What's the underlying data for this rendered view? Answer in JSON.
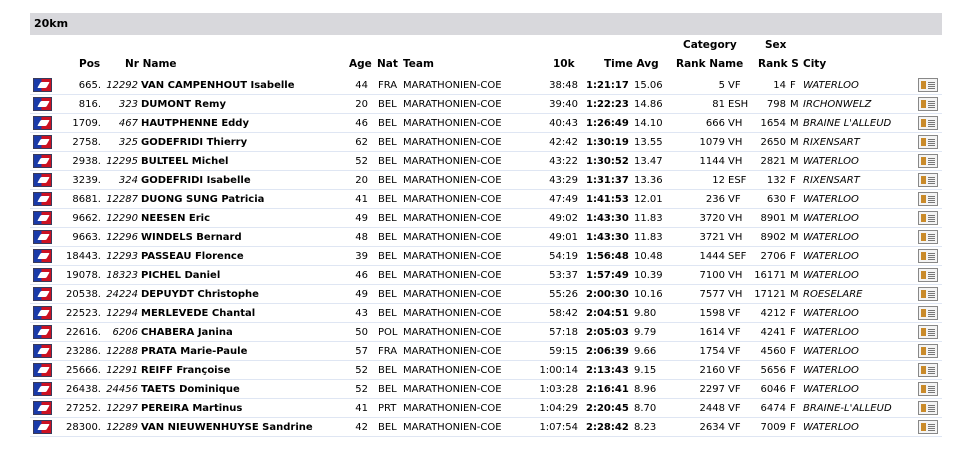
{
  "section_title": "20km",
  "headers": {
    "pos": "Pos",
    "nr_name": "Nr Name",
    "age": "Age",
    "nat": "Nat",
    "team": "Team",
    "k10": "10k",
    "time_avg": "Time Avg",
    "category": "Category",
    "rank_name": "Rank Name",
    "sex": "Sex",
    "rank_s": "Rank S",
    "city": "City"
  },
  "rows": [
    {
      "pos": "665.",
      "nr": "12292",
      "name": "VAN CAMPENHOUT Isabelle",
      "age": "44",
      "nat": "FRA",
      "team": "MARATHONIEN-COE",
      "k10": "38:48",
      "time": "1:21:17",
      "avg": "15.06",
      "rank": "5",
      "cat": "VF",
      "rank_s": "14",
      "sex": "F",
      "city": "WATERLOO"
    },
    {
      "pos": "816.",
      "nr": "323",
      "name": "DUMONT Remy",
      "age": "20",
      "nat": "BEL",
      "team": "MARATHONIEN-COE",
      "k10": "39:40",
      "time": "1:22:23",
      "avg": "14.86",
      "rank": "81",
      "cat": "ESH",
      "rank_s": "798",
      "sex": "M",
      "city": "IRCHONWELZ"
    },
    {
      "pos": "1709.",
      "nr": "467",
      "name": "HAUTPHENNE Eddy",
      "age": "46",
      "nat": "BEL",
      "team": "MARATHONIEN-COE",
      "k10": "40:43",
      "time": "1:26:49",
      "avg": "14.10",
      "rank": "666",
      "cat": "VH",
      "rank_s": "1654",
      "sex": "M",
      "city": "BRAINE L'ALLEUD"
    },
    {
      "pos": "2758.",
      "nr": "325",
      "name": "GODEFRIDI Thierry",
      "age": "62",
      "nat": "BEL",
      "team": "MARATHONIEN-COE",
      "k10": "42:42",
      "time": "1:30:19",
      "avg": "13.55",
      "rank": "1079",
      "cat": "VH",
      "rank_s": "2650",
      "sex": "M",
      "city": "RIXENSART"
    },
    {
      "pos": "2938.",
      "nr": "12295",
      "name": "BULTEEL Michel",
      "age": "52",
      "nat": "BEL",
      "team": "MARATHONIEN-COE",
      "k10": "43:22",
      "time": "1:30:52",
      "avg": "13.47",
      "rank": "1144",
      "cat": "VH",
      "rank_s": "2821",
      "sex": "M",
      "city": "WATERLOO"
    },
    {
      "pos": "3239.",
      "nr": "324",
      "name": "GODEFRIDI Isabelle",
      "age": "20",
      "nat": "BEL",
      "team": "MARATHONIEN-COE",
      "k10": "43:29",
      "time": "1:31:37",
      "avg": "13.36",
      "rank": "12",
      "cat": "ESF",
      "rank_s": "132",
      "sex": "F",
      "city": "RIXENSART"
    },
    {
      "pos": "8681.",
      "nr": "12287",
      "name": "DUONG SUNG Patricia",
      "age": "41",
      "nat": "BEL",
      "team": "MARATHONIEN-COE",
      "k10": "47:49",
      "time": "1:41:53",
      "avg": "12.01",
      "rank": "236",
      "cat": "VF",
      "rank_s": "630",
      "sex": "F",
      "city": "WATERLOO"
    },
    {
      "pos": "9662.",
      "nr": "12290",
      "name": "NEESEN Eric",
      "age": "49",
      "nat": "BEL",
      "team": "MARATHONIEN-COE",
      "k10": "49:02",
      "time": "1:43:30",
      "avg": "11.83",
      "rank": "3720",
      "cat": "VH",
      "rank_s": "8901",
      "sex": "M",
      "city": "WATERLOO"
    },
    {
      "pos": "9663.",
      "nr": "12296",
      "name": "WINDELS Bernard",
      "age": "48",
      "nat": "BEL",
      "team": "MARATHONIEN-COE",
      "k10": "49:01",
      "time": "1:43:30",
      "avg": "11.83",
      "rank": "3721",
      "cat": "VH",
      "rank_s": "8902",
      "sex": "M",
      "city": "WATERLOO"
    },
    {
      "pos": "18443.",
      "nr": "12293",
      "name": "PASSEAU Florence",
      "age": "39",
      "nat": "BEL",
      "team": "MARATHONIEN-COE",
      "k10": "54:19",
      "time": "1:56:48",
      "avg": "10.48",
      "rank": "1444",
      "cat": "SEF",
      "rank_s": "2706",
      "sex": "F",
      "city": "WATERLOO"
    },
    {
      "pos": "19078.",
      "nr": "18323",
      "name": "PICHEL Daniel",
      "age": "46",
      "nat": "BEL",
      "team": "MARATHONIEN-COE",
      "k10": "53:37",
      "time": "1:57:49",
      "avg": "10.39",
      "rank": "7100",
      "cat": "VH",
      "rank_s": "16171",
      "sex": "M",
      "city": "WATERLOO"
    },
    {
      "pos": "20538.",
      "nr": "24224",
      "name": "DEPUYDT Christophe",
      "age": "49",
      "nat": "BEL",
      "team": "MARATHONIEN-COE",
      "k10": "55:26",
      "time": "2:00:30",
      "avg": "10.16",
      "rank": "7577",
      "cat": "VH",
      "rank_s": "17121",
      "sex": "M",
      "city": "ROESELARE"
    },
    {
      "pos": "22523.",
      "nr": "12294",
      "name": "MERLEVEDE Chantal",
      "age": "43",
      "nat": "BEL",
      "team": "MARATHONIEN-COE",
      "k10": "58:42",
      "time": "2:04:51",
      "avg": "9.80",
      "rank": "1598",
      "cat": "VF",
      "rank_s": "4212",
      "sex": "F",
      "city": "WATERLOO"
    },
    {
      "pos": "22616.",
      "nr": "6206",
      "name": "CHABERA Janina",
      "age": "50",
      "nat": "POL",
      "team": "MARATHONIEN-COE",
      "k10": "57:18",
      "time": "2:05:03",
      "avg": "9.79",
      "rank": "1614",
      "cat": "VF",
      "rank_s": "4241",
      "sex": "F",
      "city": "WATERLOO"
    },
    {
      "pos": "23286.",
      "nr": "12288",
      "name": "PRATA Marie-Paule",
      "age": "57",
      "nat": "FRA",
      "team": "MARATHONIEN-COE",
      "k10": "59:15",
      "time": "2:06:39",
      "avg": "9.66",
      "rank": "1754",
      "cat": "VF",
      "rank_s": "4560",
      "sex": "F",
      "city": "WATERLOO"
    },
    {
      "pos": "25666.",
      "nr": "12291",
      "name": "REIFF Françoise",
      "age": "52",
      "nat": "BEL",
      "team": "MARATHONIEN-COE",
      "k10": "1:00:14",
      "time": "2:13:43",
      "avg": "9.15",
      "rank": "2160",
      "cat": "VF",
      "rank_s": "5656",
      "sex": "F",
      "city": "WATERLOO"
    },
    {
      "pos": "26438.",
      "nr": "24456",
      "name": "TAETS Dominique",
      "age": "52",
      "nat": "BEL",
      "team": "MARATHONIEN-COE",
      "k10": "1:03:28",
      "time": "2:16:41",
      "avg": "8.96",
      "rank": "2297",
      "cat": "VF",
      "rank_s": "6046",
      "sex": "F",
      "city": "WATERLOO"
    },
    {
      "pos": "27252.",
      "nr": "12297",
      "name": "PEREIRA Martinus",
      "age": "41",
      "nat": "PRT",
      "team": "MARATHONIEN-COE",
      "k10": "1:04:29",
      "time": "2:20:45",
      "avg": "8.70",
      "rank": "2448",
      "cat": "VF",
      "rank_s": "6474",
      "sex": "F",
      "city": "BRAINE-L'ALLEUD"
    },
    {
      "pos": "28300.",
      "nr": "12289",
      "name": "VAN NIEUWENHUYSE Sandrine",
      "age": "42",
      "nat": "BEL",
      "team": "MARATHONIEN-COE",
      "k10": "1:07:54",
      "time": "2:28:42",
      "avg": "8.23",
      "rank": "2634",
      "cat": "VF",
      "rank_s": "7009",
      "sex": "F",
      "city": "WATERLOO"
    }
  ],
  "icons": {
    "row_flag": "runner-flag-icon",
    "row_detail": "certificate-icon"
  },
  "colors": {
    "section_bg": "#d8d8dc",
    "row_separator": "#dfe6f3"
  }
}
